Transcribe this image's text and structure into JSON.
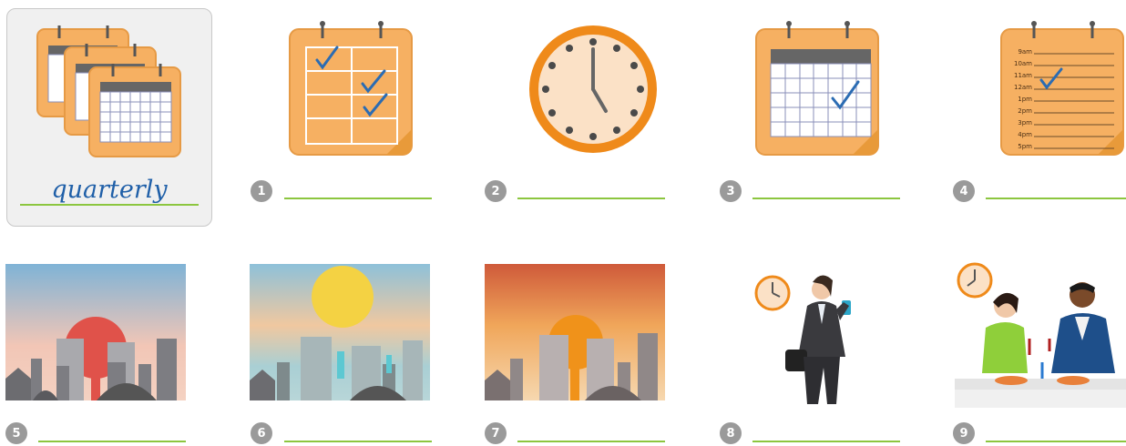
{
  "example": {
    "word": "quarterly"
  },
  "exercise": {
    "items": [
      {
        "number": "1",
        "icon": "calendar-checklist-icon",
        "answer": ""
      },
      {
        "number": "2",
        "icon": "clock-icon",
        "answer": ""
      },
      {
        "number": "3",
        "icon": "monthly-calendar-icon",
        "answer": ""
      },
      {
        "number": "4",
        "icon": "daily-planner-icon",
        "answer": ""
      },
      {
        "number": "5",
        "icon": "sunrise-city-icon",
        "answer": ""
      },
      {
        "number": "6",
        "icon": "midday-sun-city-icon",
        "answer": ""
      },
      {
        "number": "7",
        "icon": "sunset-city-icon",
        "answer": ""
      },
      {
        "number": "8",
        "icon": "businesswoman-phone-icon",
        "answer": ""
      },
      {
        "number": "9",
        "icon": "dinner-couple-icon",
        "answer": ""
      }
    ]
  },
  "planner_times": [
    "9am",
    "10am",
    "11am",
    "12am",
    "1pm",
    "2pm",
    "3pm",
    "4pm",
    "5pm"
  ],
  "colors": {
    "calendar_orange": "#f6b062",
    "calendar_border": "#e69a45",
    "clock_ring": "#ef8a1a",
    "check_blue": "#2b6cb3",
    "answer_line": "#8cc63f",
    "number_badge": "#9a9a9a"
  }
}
